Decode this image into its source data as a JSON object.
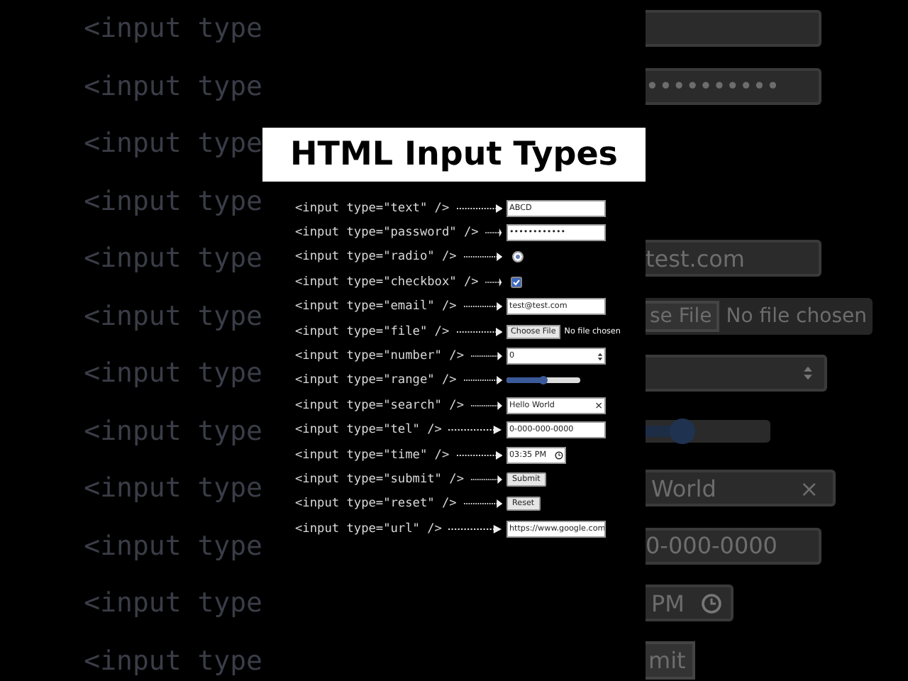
{
  "title": "HTML Input Types",
  "background_code": [
    "<input type",
    "<input type",
    "<input type",
    "<input type",
    "<input type",
    "<input type",
    "<input type",
    "<input type",
    "<input type",
    "<input type",
    "<input type",
    "<input type"
  ],
  "background_widgets": [
    {
      "kind": "field"
    },
    {
      "kind": "field",
      "value": "••••••••••"
    },
    {
      "kind": "blank"
    },
    {
      "kind": "blank"
    },
    {
      "kind": "field",
      "value": "test.com"
    },
    {
      "kind": "file",
      "button": "se File",
      "status": "No file chosen"
    },
    {
      "kind": "number"
    },
    {
      "kind": "range",
      "level": 0.3
    },
    {
      "kind": "search",
      "value": "World",
      "clear": "×"
    },
    {
      "kind": "field",
      "value": "0-000-0000"
    },
    {
      "kind": "time",
      "value": "PM"
    },
    {
      "kind": "button",
      "label": "mit"
    }
  ],
  "rows": [
    {
      "code": "<input type=\"text\" />",
      "kind": "text",
      "value": "ABCD"
    },
    {
      "code": "<input type=\"password\" />",
      "kind": "text",
      "value": "••••••••••••"
    },
    {
      "code": "<input type=\"radio\" />",
      "kind": "radio",
      "checked": true
    },
    {
      "code": "<input type=\"checkbox\" />",
      "kind": "checkbox",
      "checked": true
    },
    {
      "code": "<input type=\"email\" />",
      "kind": "text",
      "value": "test@test.com"
    },
    {
      "code": "<input type=\"file\" />",
      "kind": "file",
      "button": "Choose File",
      "status": "No file chosen"
    },
    {
      "code": "<input type=\"number\" />",
      "kind": "number",
      "value": "0"
    },
    {
      "code": "<input type=\"range\" />",
      "kind": "range",
      "level": 0.5
    },
    {
      "code": "<input type=\"search\" />",
      "kind": "search",
      "value": "Hello World",
      "clear": "×"
    },
    {
      "code": "<input type=\"tel\" />",
      "kind": "text",
      "value": "0-000-000-0000"
    },
    {
      "code": "<input type=\"time\" />",
      "kind": "time",
      "value": "03:35 PM"
    },
    {
      "code": "<input type=\"submit\" />",
      "kind": "button",
      "label": "Submit"
    },
    {
      "code": "<input type=\"reset\" />",
      "kind": "button",
      "label": "Reset"
    },
    {
      "code": "<input type=\"url\" />",
      "kind": "text",
      "value": "https://www.google.com"
    }
  ]
}
